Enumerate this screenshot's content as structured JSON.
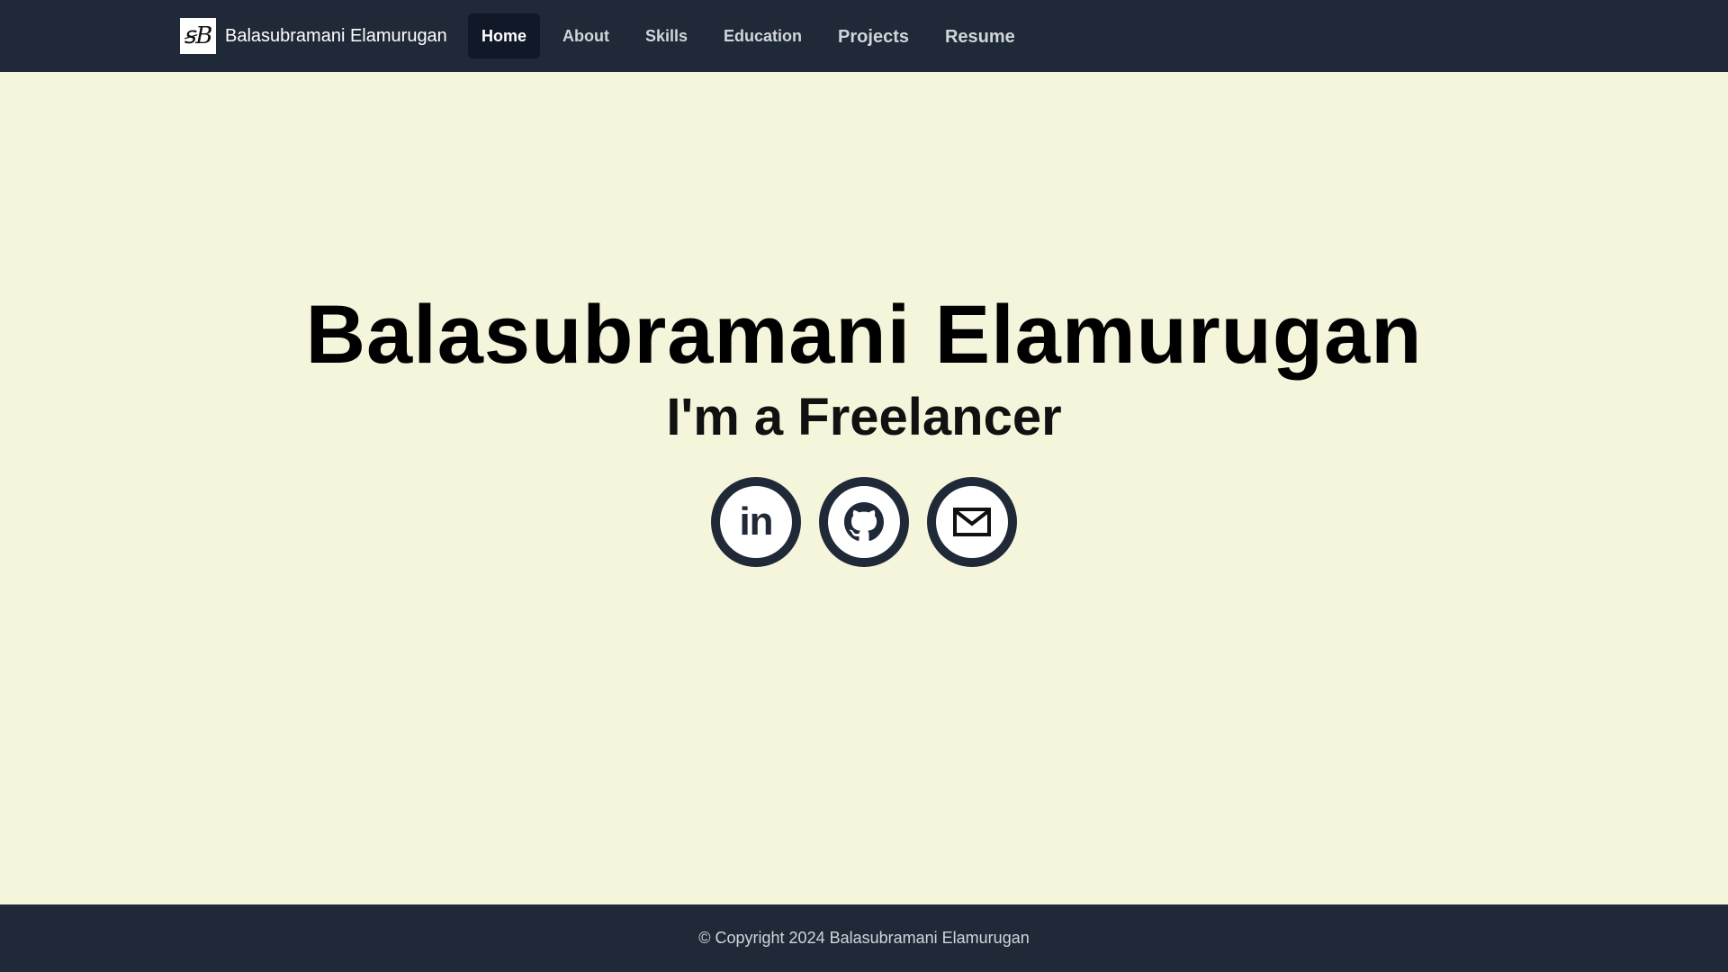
{
  "brand": {
    "logo_text": "ꞩB",
    "name": "Balasubramani Elamurugan"
  },
  "nav": {
    "items": [
      {
        "label": "Home",
        "active": true
      },
      {
        "label": "About"
      },
      {
        "label": "Skills"
      },
      {
        "label": "Education"
      },
      {
        "label": "Projects"
      },
      {
        "label": "Resume"
      }
    ]
  },
  "hero": {
    "name": "Balasubramani Elamurugan",
    "tagline": "I'm a Freelancer"
  },
  "socials": [
    {
      "icon": "linkedin-icon",
      "text": "in"
    },
    {
      "icon": "github-icon"
    },
    {
      "icon": "mail-icon"
    }
  ],
  "footer": {
    "text": "© Copyright 2024 Balasubramani Elamurugan"
  },
  "colors": {
    "navbar": "#1f2937",
    "background": "#f5f5dc",
    "active_nav": "#111827"
  }
}
